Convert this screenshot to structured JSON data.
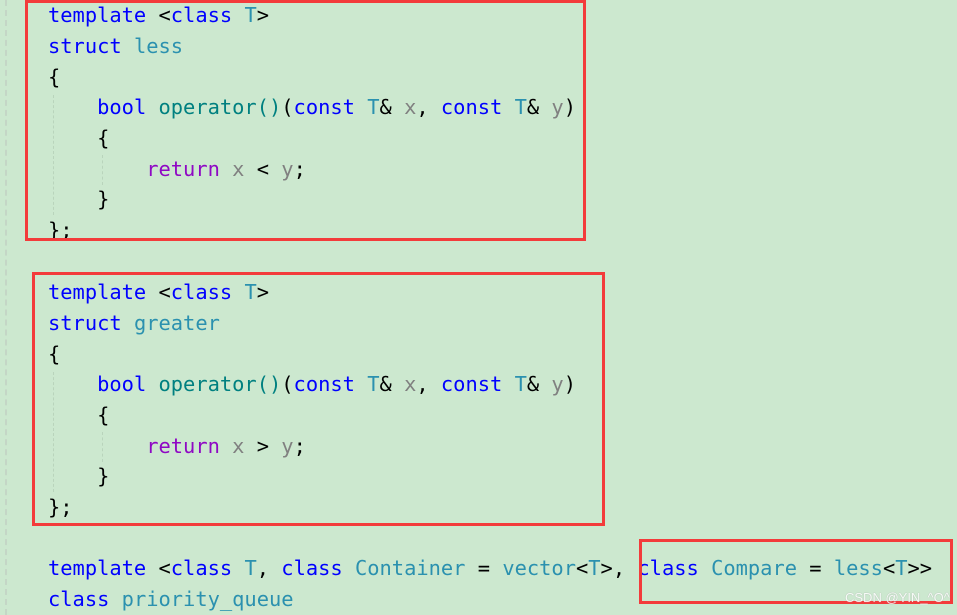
{
  "colors": {
    "keyword": "#0000ff",
    "type": "#2b91af",
    "func": "#008080",
    "param": "#808080",
    "control": "#8f08c4",
    "punct": "#000000",
    "highlight": "#f33b3b",
    "background": "#cce8cf"
  },
  "code": [
    [
      [
        "keyword",
        "template"
      ],
      [
        "punct",
        " <"
      ],
      [
        "keyword",
        "class"
      ],
      [
        "punct",
        " "
      ],
      [
        "type",
        "T"
      ],
      [
        "punct",
        ">"
      ]
    ],
    [
      [
        "keyword",
        "struct"
      ],
      [
        "punct",
        " "
      ],
      [
        "type",
        "less"
      ]
    ],
    [
      [
        "punct",
        "{"
      ]
    ],
    [
      [
        "punct",
        "    "
      ],
      [
        "keyword",
        "bool"
      ],
      [
        "punct",
        " "
      ],
      [
        "func",
        "operator()"
      ],
      [
        "punct",
        "("
      ],
      [
        "keyword",
        "const"
      ],
      [
        "punct",
        " "
      ],
      [
        "type",
        "T"
      ],
      [
        "punct",
        "& "
      ],
      [
        "param",
        "x"
      ],
      [
        "punct",
        ", "
      ],
      [
        "keyword",
        "const"
      ],
      [
        "punct",
        " "
      ],
      [
        "type",
        "T"
      ],
      [
        "punct",
        "& "
      ],
      [
        "param",
        "y"
      ],
      [
        "punct",
        ")"
      ]
    ],
    [
      [
        "punct",
        "    {"
      ]
    ],
    [
      [
        "punct",
        "        "
      ],
      [
        "control",
        "return"
      ],
      [
        "punct",
        " "
      ],
      [
        "param",
        "x"
      ],
      [
        "punct",
        " < "
      ],
      [
        "param",
        "y"
      ],
      [
        "punct",
        ";"
      ]
    ],
    [
      [
        "punct",
        "    }"
      ]
    ],
    [
      [
        "punct",
        "};"
      ]
    ],
    [
      [
        "keyword",
        "template"
      ],
      [
        "punct",
        " <"
      ],
      [
        "keyword",
        "class"
      ],
      [
        "punct",
        " "
      ],
      [
        "type",
        "T"
      ],
      [
        "punct",
        ">"
      ]
    ],
    [
      [
        "keyword",
        "struct"
      ],
      [
        "punct",
        " "
      ],
      [
        "type",
        "greater"
      ]
    ],
    [
      [
        "punct",
        "{"
      ]
    ],
    [
      [
        "punct",
        "    "
      ],
      [
        "keyword",
        "bool"
      ],
      [
        "punct",
        " "
      ],
      [
        "func",
        "operator()"
      ],
      [
        "punct",
        "("
      ],
      [
        "keyword",
        "const"
      ],
      [
        "punct",
        " "
      ],
      [
        "type",
        "T"
      ],
      [
        "punct",
        "& "
      ],
      [
        "param",
        "x"
      ],
      [
        "punct",
        ", "
      ],
      [
        "keyword",
        "const"
      ],
      [
        "punct",
        " "
      ],
      [
        "type",
        "T"
      ],
      [
        "punct",
        "& "
      ],
      [
        "param",
        "y"
      ],
      [
        "punct",
        ")"
      ]
    ],
    [
      [
        "punct",
        "    {"
      ]
    ],
    [
      [
        "punct",
        "        "
      ],
      [
        "control",
        "return"
      ],
      [
        "punct",
        " "
      ],
      [
        "param",
        "x"
      ],
      [
        "punct",
        " > "
      ],
      [
        "param",
        "y"
      ],
      [
        "punct",
        ";"
      ]
    ],
    [
      [
        "punct",
        "    }"
      ]
    ],
    [
      [
        "punct",
        "};"
      ]
    ],
    [
      [
        "keyword",
        "template"
      ],
      [
        "punct",
        " <"
      ],
      [
        "keyword",
        "class"
      ],
      [
        "punct",
        " "
      ],
      [
        "type",
        "T"
      ],
      [
        "punct",
        ", "
      ],
      [
        "keyword",
        "class"
      ],
      [
        "punct",
        " "
      ],
      [
        "type",
        "Container"
      ],
      [
        "punct",
        " = "
      ],
      [
        "type",
        "vector"
      ],
      [
        "punct",
        "<"
      ],
      [
        "type",
        "T"
      ],
      [
        "punct",
        ">, "
      ],
      [
        "keyword",
        "class"
      ],
      [
        "punct",
        " "
      ],
      [
        "type",
        "Compare"
      ],
      [
        "punct",
        " = "
      ],
      [
        "type",
        "less"
      ],
      [
        "punct",
        "<"
      ],
      [
        "type",
        "T"
      ],
      [
        "punct",
        ">>"
      ]
    ],
    [
      [
        "keyword",
        "class"
      ],
      [
        "punct",
        " "
      ],
      [
        "type",
        "priority_queue"
      ]
    ]
  ],
  "watermark": "CSDN @YIN_^O^"
}
